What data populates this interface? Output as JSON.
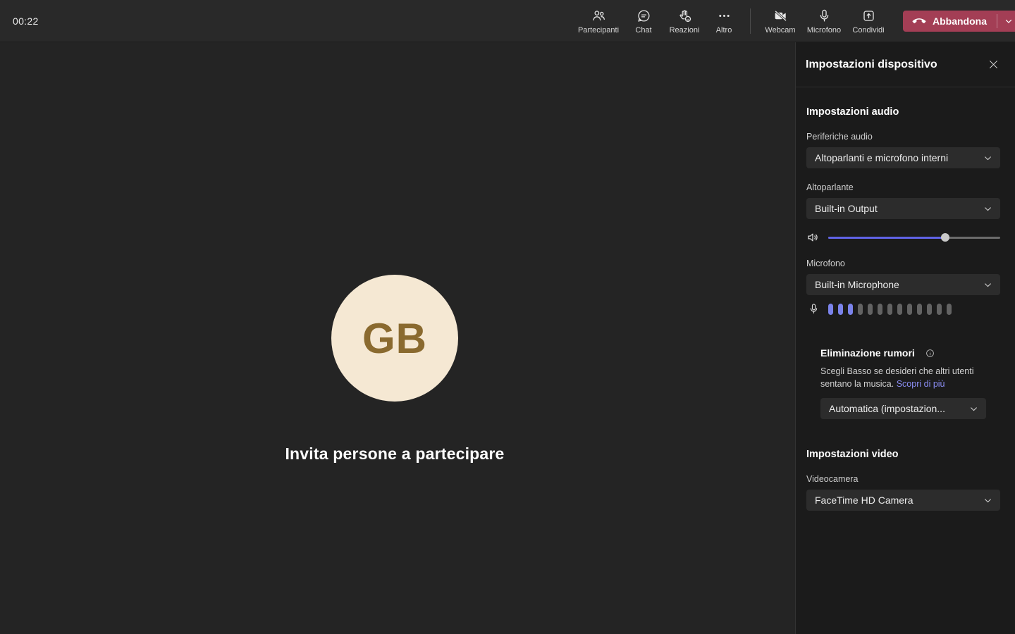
{
  "topbar": {
    "timer": "00:22",
    "tools": [
      {
        "label": "Partecipanti"
      },
      {
        "label": "Chat"
      },
      {
        "label": "Reazioni"
      },
      {
        "label": "Altro"
      }
    ],
    "devices": [
      {
        "label": "Webcam"
      },
      {
        "label": "Microfono"
      },
      {
        "label": "Condividi"
      }
    ],
    "leave_label": "Abbandona"
  },
  "stage": {
    "avatar_initials": "GB",
    "invite_text": "Invita persone a partecipare"
  },
  "panel": {
    "title": "Impostazioni dispositivo",
    "audio": {
      "section_title": "Impostazioni audio",
      "devices_label": "Periferiche audio",
      "devices_value": "Altoparlanti e microfono interni",
      "speaker_label": "Altoparlante",
      "speaker_value": "Built-in Output",
      "volume_percent": 68,
      "mic_label": "Microfono",
      "mic_value": "Built-in Microphone",
      "mic_level": {
        "total": 13,
        "active": 3
      },
      "noise": {
        "title": "Eliminazione rumori",
        "description": "Scegli Basso se desideri che altri utenti sentano la musica.",
        "link_label": "Scopri di più",
        "value": "Automatica (impostazion..."
      }
    },
    "video": {
      "section_title": "Impostazioni video",
      "camera_label": "Videocamera",
      "camera_value": "FaceTime HD Camera"
    }
  },
  "colors": {
    "accent": "#7b83eb",
    "slider_fill": "#6063e6",
    "leave_red": "#a33e55",
    "link": "#8a8df2",
    "avatar_bg": "#f5e8d3",
    "avatar_text": "#8a6a2f",
    "topbar_bg": "#292929",
    "stage_bg": "#242424",
    "panel_bg": "#1b1b1b"
  }
}
